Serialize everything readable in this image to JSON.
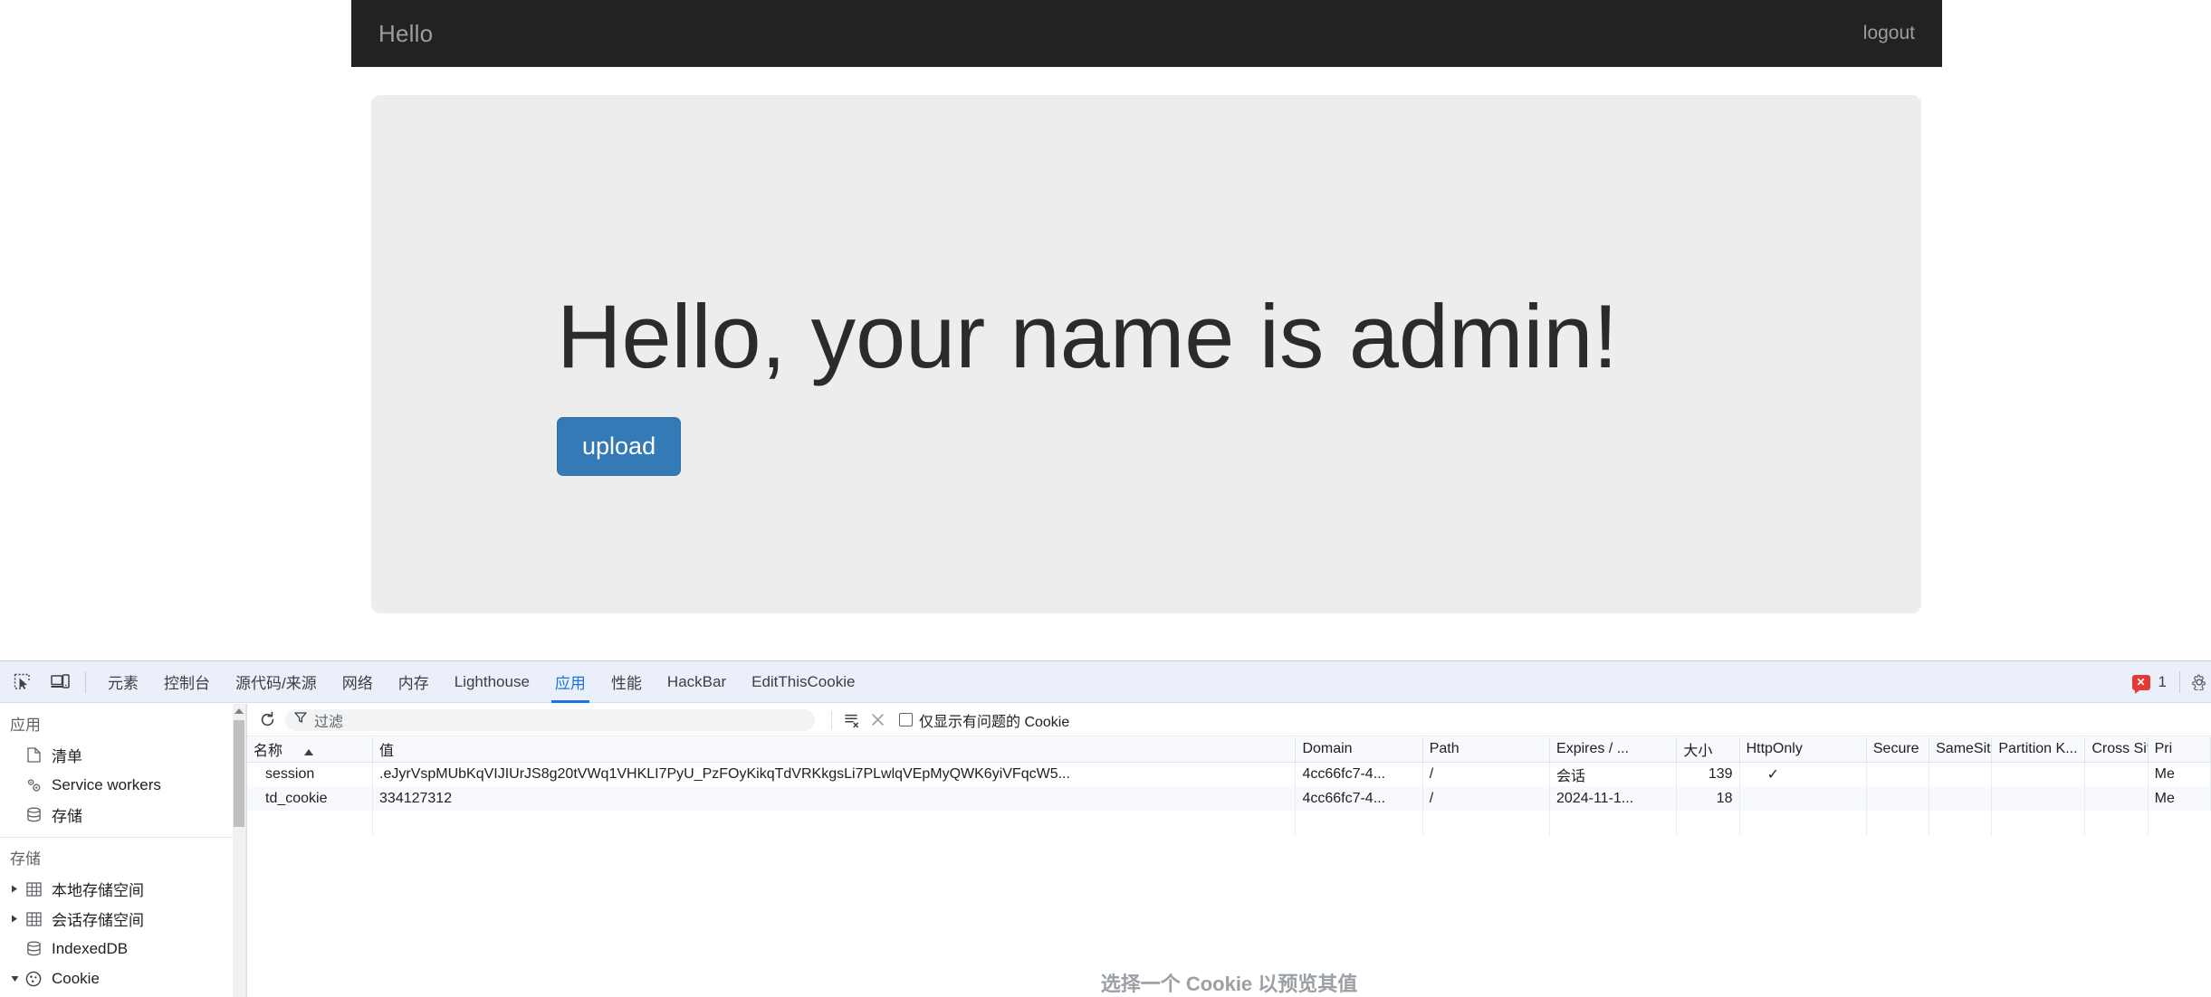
{
  "webpage": {
    "navbar": {
      "brand": "Hello",
      "logout_label": "logout"
    },
    "jumbotron": {
      "heading": "Hello, your name is admin!",
      "upload_button": "upload"
    }
  },
  "devtools": {
    "icons": {
      "inspect": "inspect-element-icon",
      "device": "device-toolbar-icon"
    },
    "tabs": [
      {
        "label": "元素",
        "active": false
      },
      {
        "label": "控制台",
        "active": false
      },
      {
        "label": "源代码/来源",
        "active": false
      },
      {
        "label": "网络",
        "active": false
      },
      {
        "label": "内存",
        "active": false
      },
      {
        "label": "Lighthouse",
        "active": false
      },
      {
        "label": "应用",
        "active": true
      },
      {
        "label": "性能",
        "active": false
      },
      {
        "label": "HackBar",
        "active": false
      },
      {
        "label": "EditThisCookie",
        "active": false
      }
    ],
    "status": {
      "error_badge": "✕",
      "error_count": "1"
    },
    "sidebar": {
      "groups": [
        {
          "title": "应用",
          "items": [
            {
              "label": "清单",
              "icon": "manifest-document-icon",
              "twisty": "none"
            },
            {
              "label": "Service workers",
              "icon": "service-workers-gears-icon",
              "twisty": "none"
            },
            {
              "label": "存储",
              "icon": "storage-database-icon",
              "twisty": "none"
            }
          ]
        },
        {
          "title": "存储",
          "items": [
            {
              "label": "本地存储空间",
              "icon": "table-grid-icon",
              "twisty": "collapsed"
            },
            {
              "label": "会话存储空间",
              "icon": "table-grid-icon",
              "twisty": "collapsed"
            },
            {
              "label": "IndexedDB",
              "icon": "storage-database-icon",
              "twisty": "none"
            },
            {
              "label": "Cookie",
              "icon": "cookie-icon",
              "twisty": "expanded"
            }
          ]
        }
      ]
    },
    "cookie_panel": {
      "toolbar": {
        "refresh_icon": "refresh-icon",
        "filter_icon": "filter-funnel-icon",
        "filter_placeholder": "过滤",
        "clear_filtered_icon": "clear-filtered-cookies-icon",
        "clear_all_icon": "clear-all-cookies-icon",
        "only_problems_label": "仅显示有问题的 Cookie",
        "only_problems_checked": false
      },
      "columns": [
        "名称",
        "值",
        "Domain",
        "Path",
        "Expires / ...",
        "大小",
        "HttpOnly",
        "Secure",
        "SameSite",
        "Partition K...",
        "Cross Site",
        "Pri"
      ],
      "sorted_column": "名称",
      "sort_direction": "ascending",
      "rows": [
        {
          "name": "session",
          "value": ".eJyrVspMUbKqVIJIUrJS8g20tVWq1VHKLI7PyU_PzFOyKikqTdVRKkgsLi7PLwlqVEpMyQWK6yiVFqcW5...",
          "domain": "4cc66fc7-4...",
          "path": "/",
          "expires": "会话",
          "size": "139",
          "httponly": "✓",
          "secure": "",
          "samesite": "",
          "partition_key": "",
          "cross_site": "",
          "priority": "Me"
        },
        {
          "name": "td_cookie",
          "value": "334127312",
          "domain": "4cc66fc7-4...",
          "path": "/",
          "expires": "2024-11-1...",
          "size": "18",
          "httponly": "",
          "secure": "",
          "samesite": "",
          "partition_key": "",
          "cross_site": "",
          "priority": "Me"
        }
      ],
      "preview_placeholder": "选择一个 Cookie 以预览其值"
    }
  }
}
